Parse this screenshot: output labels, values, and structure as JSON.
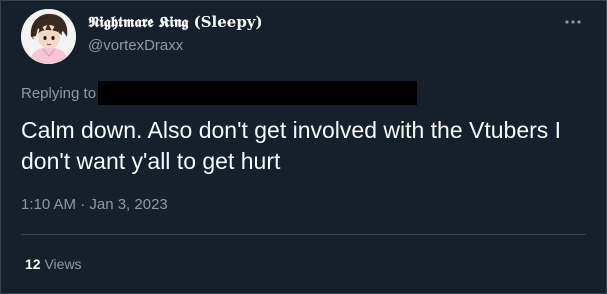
{
  "author": {
    "display_name": "𝕹𝖎𝖌𝖍𝖙𝖒𝖆𝖗𝖊 𝕶𝖎𝖓𝖌 (Sleepy)",
    "handle": "@vortexDraxx"
  },
  "reply": {
    "label": "Replying to"
  },
  "tweet": {
    "text": "Calm down. Also don't get involved with the Vtubers I don't want y'all to get hurt",
    "timestamp": "1:10 AM · Jan 3, 2023"
  },
  "stats": {
    "views_count": "12",
    "views_label": "Views"
  },
  "icons": {
    "more": "more-horizontal-icon"
  },
  "colors": {
    "background": "#15202b",
    "text_primary": "#f7f9f9",
    "text_secondary": "#8b98a5",
    "divider": "#38444d"
  }
}
